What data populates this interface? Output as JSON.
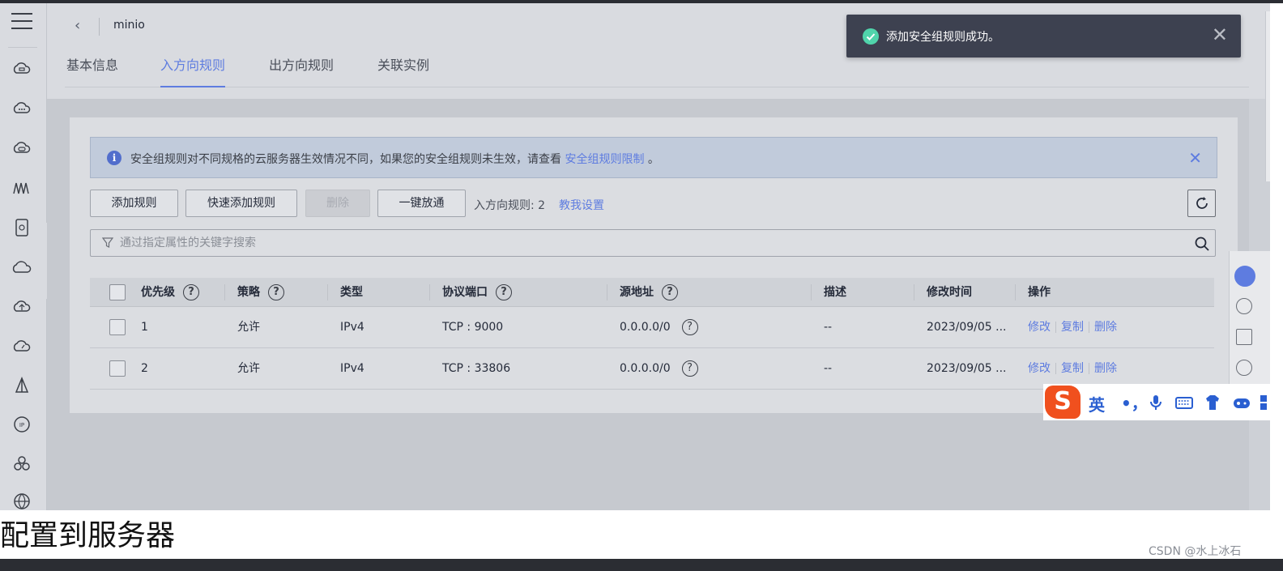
{
  "breadcrumb": {
    "back_icon": "chevron-left-icon",
    "title": "minio"
  },
  "tabs": [
    {
      "label": "基本信息",
      "active": false
    },
    {
      "label": "入方向规则",
      "active": true
    },
    {
      "label": "出方向规则",
      "active": false
    },
    {
      "label": "关联实例",
      "active": false
    }
  ],
  "toast": {
    "icon": "check-circle-icon",
    "message": "添加安全组规则成功。",
    "color": "#3d4150"
  },
  "notice": {
    "text": "安全组规则对不同规格的云服务器生效情况不同，如果您的安全组规则未生效，请查看",
    "link": "安全组规则限制",
    "suffix": "。"
  },
  "toolbar": {
    "add_rule": "添加规则",
    "quick_add": "快速添加规则",
    "delete": "删除",
    "one_click": "一键放通",
    "inbound_count": "入方向规则: 2",
    "teach_me": "教我设置"
  },
  "search": {
    "placeholder": "通过指定属性的关键字搜索"
  },
  "table": {
    "headers": [
      "优先级",
      "策略",
      "类型",
      "协议端口",
      "源地址",
      "描述",
      "修改时间",
      "操作"
    ],
    "rows": [
      {
        "priority": "1",
        "policy": "允许",
        "type": "IPv4",
        "port": "TCP : 9000",
        "source": "0.0.0.0/0",
        "desc": "--",
        "modified": "2023/09/05 ...",
        "ops": [
          "修改",
          "复制",
          "删除"
        ]
      },
      {
        "priority": "2",
        "policy": "允许",
        "type": "IPv4",
        "port": "TCP : 33806",
        "source": "0.0.0.0/0",
        "desc": "--",
        "modified": "2023/09/05 ...",
        "ops": [
          "修改",
          "复制",
          "删除"
        ]
      }
    ]
  },
  "ime": {
    "logo": "S",
    "mode": "英",
    "punct": "•，"
  },
  "page_heading": "配置到服务器",
  "watermark": "CSDN @水上冰石",
  "colors": {
    "accent": "#5e7ce0",
    "success": "#50d4ab",
    "ime_logo": "#f0501e"
  }
}
